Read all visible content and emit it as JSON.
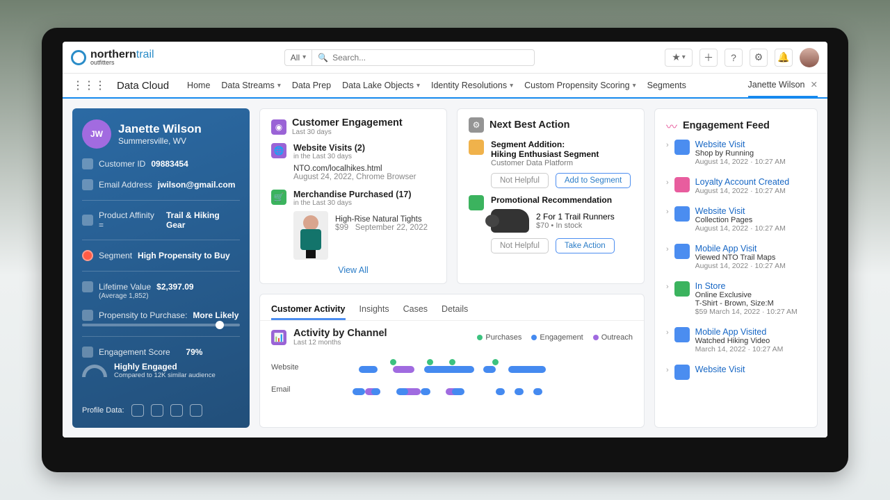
{
  "brand": {
    "name": "northern",
    "trail": "trail",
    "tag": "outfitters"
  },
  "search": {
    "scope": "All",
    "placeholder": "Search..."
  },
  "nav": {
    "app": "Data Cloud",
    "items": [
      "Home",
      "Data Streams",
      "Data Prep",
      "Data Lake Objects",
      "Identity Resolutions",
      "Custom Propensity Scoring",
      "Segments",
      "Janette Wilson"
    ]
  },
  "profile": {
    "initials": "JW",
    "name": "Janette Wilson",
    "loc": "Summersville, WV",
    "id_label": "Customer ID",
    "id": "09883454",
    "email_label": "Email Address",
    "email": "jwilson@gmail.com",
    "affinity_label": "Product Affinity =",
    "affinity": "Trail & Hiking Gear",
    "segment_label": "Segment",
    "segment": "High Propensity to Buy",
    "ltv_label": "Lifetime Value",
    "ltv": "$2,397.09",
    "ltv_sub": "(Average 1,852)",
    "prop_label": "Propensity to Purchase:",
    "prop_val": "More Likely",
    "eng_label": "Engagement Score",
    "eng_pct": "79%",
    "eng_title": "Highly Engaged",
    "eng_sub": "Compared to 12K similar audience",
    "foot_label": "Profile Data:"
  },
  "ce": {
    "title": "Customer Engagement",
    "sub": "Last 30 days",
    "visits_title": "Website Visits (2)",
    "visits_sub": "in the Last 30 days",
    "visits_l1": "NTO.com/localhikes.html",
    "visits_l2": "August 24, 2022, Chrome Browser",
    "merch_title": "Merchandise Purchased (17)",
    "merch_sub": "in the Last 30 days",
    "merch_item": "High-Rise Natural Tights",
    "merch_price": "$99",
    "merch_date": "September 22, 2022",
    "view_all": "View All"
  },
  "nba": {
    "title": "Next Best Action",
    "a_title": "Segment Addition:",
    "a_line": "Hiking Enthusiast Segment",
    "a_sub": "Customer Data Platform",
    "a_btn1": "Not Helpful",
    "a_btn2": "Add to Segment",
    "b_title": "Promotional Recommendation",
    "b_line": "2 For 1 Trail Runners",
    "b_sub": "$70  •  In stock",
    "b_btn1": "Not Helpful",
    "b_btn2": "Take Action"
  },
  "tabs": {
    "t1": "Customer Activity",
    "t2": "Insights",
    "t3": "Cases",
    "t4": "Details",
    "chart_title": "Activity by Channel",
    "chart_sub": "Last 12 months",
    "lg1": "Purchases",
    "lg2": "Engagement",
    "lg3": "Outreach",
    "r1": "Website",
    "r2": "Email"
  },
  "feed": {
    "title": "Engagement Feed",
    "items": [
      {
        "ico": "blue",
        "title": "Website Visit",
        "sub": "Shop by Running",
        "time": "August 14, 2022 · 10:27 AM"
      },
      {
        "ico": "pink",
        "title": "Loyalty Account Created",
        "sub": "",
        "time": "August 14, 2022 · 10:27 AM"
      },
      {
        "ico": "blue",
        "title": "Website Visit",
        "sub": "Collection Pages",
        "time": "August 14, 2022 · 10:27 AM"
      },
      {
        "ico": "blue",
        "title": "Mobile App Visit",
        "sub": "Viewed NTO Trail Maps",
        "time": "August 14, 2022 · 10:27 AM"
      },
      {
        "ico": "green",
        "title": "In Store",
        "sub": "Online Exclusive",
        "sub2": "T-Shirt - Brown, Size:M",
        "sub3": "$59   March 14, 2022 · 10:27 AM",
        "time": ""
      },
      {
        "ico": "blue",
        "title": "Mobile App Visited",
        "sub": "Watched Hiking Video",
        "time": "March 14, 2022 · 10:27 AM"
      },
      {
        "ico": "blue",
        "title": "Website Visit",
        "sub": "",
        "time": ""
      }
    ]
  },
  "chart_data": {
    "type": "timeline",
    "title": "Activity by Channel",
    "xlabel": "",
    "ylabel": "",
    "series": [
      {
        "name": "Website",
        "events": [
          {
            "kind": "purchase",
            "x": 22
          },
          {
            "kind": "purchase",
            "x": 34
          },
          {
            "kind": "purchase",
            "x": 41
          },
          {
            "kind": "purchase",
            "x": 55
          },
          {
            "kind": "engagement",
            "x": 12,
            "w": 6
          },
          {
            "kind": "outreach",
            "x": 23,
            "w": 7
          },
          {
            "kind": "engagement",
            "x": 33,
            "w": 16
          },
          {
            "kind": "engagement",
            "x": 52,
            "w": 4
          },
          {
            "kind": "engagement",
            "x": 60,
            "w": 12
          }
        ]
      },
      {
        "name": "Email",
        "events": [
          {
            "kind": "outreach",
            "x": 14,
            "w": 5
          },
          {
            "kind": "outreach",
            "x": 26,
            "w": 6
          },
          {
            "kind": "outreach",
            "x": 40,
            "w": 5
          },
          {
            "kind": "engagement",
            "x": 10,
            "w": 4
          },
          {
            "kind": "engagement",
            "x": 16,
            "w": 3
          },
          {
            "kind": "engagement",
            "x": 24,
            "w": 4
          },
          {
            "kind": "engagement",
            "x": 32,
            "w": 3
          },
          {
            "kind": "engagement",
            "x": 42,
            "w": 4
          },
          {
            "kind": "engagement",
            "x": 56,
            "w": 3
          },
          {
            "kind": "engagement",
            "x": 62,
            "w": 3
          },
          {
            "kind": "engagement",
            "x": 68,
            "w": 3
          }
        ]
      }
    ],
    "legend": [
      "Purchases",
      "Engagement",
      "Outreach"
    ]
  }
}
